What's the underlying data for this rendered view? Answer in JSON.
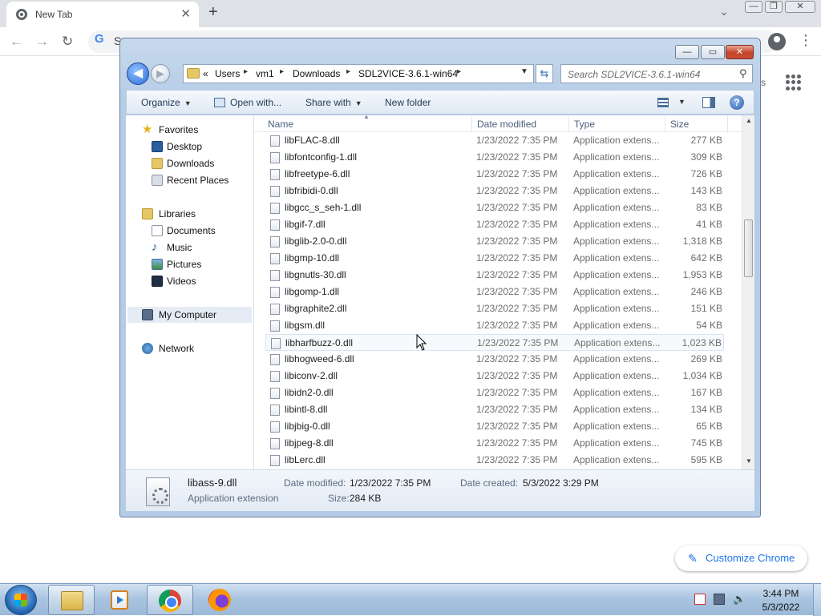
{
  "browser": {
    "tab_title": "New Tab",
    "tab_close": "✕",
    "new_tab": "+",
    "tab_search": "⌄",
    "omnibox_g": "G",
    "omnibox_text": "S",
    "back": "←",
    "forward": "→",
    "reload": "↻",
    "menu": "⋮",
    "ntp_partial": "s",
    "customize_label": "Customize Chrome",
    "customize_icon": "pencil-icon",
    "window_controls": [
      "—",
      "❐",
      "✕"
    ]
  },
  "explorer": {
    "title_controls": [
      "—",
      "▭",
      "✕"
    ],
    "breadcrumb": [
      "«",
      "Users",
      "vm1",
      "Downloads",
      "SDL2VICE-3.6.1-win64"
    ],
    "search_placeholder": "Search SDL2VICE-3.6.1-win64",
    "toolbar": {
      "organize": "Organize",
      "open_with": "Open with...",
      "share_with": "Share with",
      "new_folder": "New folder"
    },
    "nav": {
      "favorites": "Favorites",
      "desktop": "Desktop",
      "downloads": "Downloads",
      "recent_places": "Recent Places",
      "libraries": "Libraries",
      "documents": "Documents",
      "music": "Music",
      "pictures": "Pictures",
      "videos": "Videos",
      "my_computer": "My Computer",
      "network": "Network"
    },
    "columns": {
      "name": "Name",
      "date_modified": "Date modified",
      "type": "Type",
      "size": "Size"
    },
    "files": [
      {
        "name": "libFLAC-8.dll",
        "date": "1/23/2022 7:35 PM",
        "type": "Application extens...",
        "size": "277 KB"
      },
      {
        "name": "libfontconfig-1.dll",
        "date": "1/23/2022 7:35 PM",
        "type": "Application extens...",
        "size": "309 KB"
      },
      {
        "name": "libfreetype-6.dll",
        "date": "1/23/2022 7:35 PM",
        "type": "Application extens...",
        "size": "726 KB"
      },
      {
        "name": "libfribidi-0.dll",
        "date": "1/23/2022 7:35 PM",
        "type": "Application extens...",
        "size": "143 KB"
      },
      {
        "name": "libgcc_s_seh-1.dll",
        "date": "1/23/2022 7:35 PM",
        "type": "Application extens...",
        "size": "83 KB"
      },
      {
        "name": "libgif-7.dll",
        "date": "1/23/2022 7:35 PM",
        "type": "Application extens...",
        "size": "41 KB"
      },
      {
        "name": "libglib-2.0-0.dll",
        "date": "1/23/2022 7:35 PM",
        "type": "Application extens...",
        "size": "1,318 KB"
      },
      {
        "name": "libgmp-10.dll",
        "date": "1/23/2022 7:35 PM",
        "type": "Application extens...",
        "size": "642 KB"
      },
      {
        "name": "libgnutls-30.dll",
        "date": "1/23/2022 7:35 PM",
        "type": "Application extens...",
        "size": "1,953 KB"
      },
      {
        "name": "libgomp-1.dll",
        "date": "1/23/2022 7:35 PM",
        "type": "Application extens...",
        "size": "246 KB"
      },
      {
        "name": "libgraphite2.dll",
        "date": "1/23/2022 7:35 PM",
        "type": "Application extens...",
        "size": "151 KB"
      },
      {
        "name": "libgsm.dll",
        "date": "1/23/2022 7:35 PM",
        "type": "Application extens...",
        "size": "54 KB"
      },
      {
        "name": "libharfbuzz-0.dll",
        "date": "1/23/2022 7:35 PM",
        "type": "Application extens...",
        "size": "1,023 KB"
      },
      {
        "name": "libhogweed-6.dll",
        "date": "1/23/2022 7:35 PM",
        "type": "Application extens...",
        "size": "269 KB"
      },
      {
        "name": "libiconv-2.dll",
        "date": "1/23/2022 7:35 PM",
        "type": "Application extens...",
        "size": "1,034 KB"
      },
      {
        "name": "libidn2-0.dll",
        "date": "1/23/2022 7:35 PM",
        "type": "Application extens...",
        "size": "167 KB"
      },
      {
        "name": "libintl-8.dll",
        "date": "1/23/2022 7:35 PM",
        "type": "Application extens...",
        "size": "134 KB"
      },
      {
        "name": "libjbig-0.dll",
        "date": "1/23/2022 7:35 PM",
        "type": "Application extens...",
        "size": "65 KB"
      },
      {
        "name": "libjpeg-8.dll",
        "date": "1/23/2022 7:35 PM",
        "type": "Application extens...",
        "size": "745 KB"
      },
      {
        "name": "libLerc.dll",
        "date": "1/23/2022 7:35 PM",
        "type": "Application extens...",
        "size": "595 KB"
      }
    ],
    "details": {
      "name": "libass-9.dll",
      "type": "Application extension",
      "date_modified_label": "Date modified:",
      "date_modified": "1/23/2022 7:35 PM",
      "date_created_label": "Date created:",
      "date_created": "5/3/2022 3:29 PM",
      "size_label": "Size:",
      "size": "284 KB"
    }
  },
  "taskbar": {
    "time": "3:44 PM",
    "date": "5/3/2022"
  }
}
